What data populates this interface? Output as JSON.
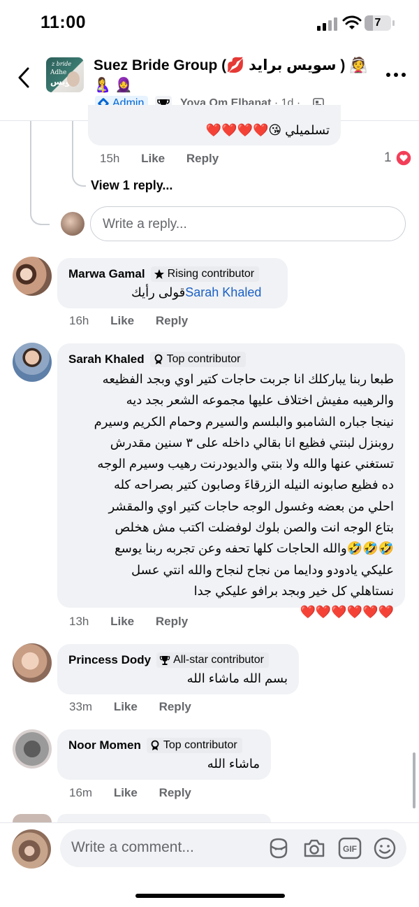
{
  "status_bar": {
    "time": "11:00",
    "battery": "7"
  },
  "header": {
    "group_name": "Suez Bride Group (💋 سويس برايد ) 👰",
    "group_name_emoji_tail": "🤰",
    "group_name_emoji_line2": "🤱 🧕",
    "avatar_text_1": "z bride",
    "avatar_text_2": "Adhe",
    "avatar_text_3": "سويس",
    "admin_label": "Admin",
    "author": "Yoya Om Elbanat",
    "age": "· 1d ·"
  },
  "thread": {
    "prev_reply": {
      "text": "تسلميلي 😘❤️❤️❤️❤️",
      "time": "15h",
      "like": "Like",
      "reply": "Reply",
      "reaction_count": "1"
    },
    "view_replies": "View 1 reply...",
    "reply_input_placeholder": "Write a reply..."
  },
  "comments": [
    {
      "name": "Marwa Gamal",
      "badge": "Rising contributor",
      "mention": "Sarah Khaled",
      "text": "قولى رأيك",
      "time": "16h",
      "like": "Like",
      "reply": "Reply"
    },
    {
      "name": "Sarah Khaled",
      "badge": "Top contributor",
      "lines": [
        "طبعا ربنا يباركلك انا جربت حاجات كتير اوي وبجد الفظيعه",
        "والرهيبه مفيش اختلاف عليها مجموعه الشعر بجد ديه",
        "نينجا جباره الشامبو والبلسم والسيرم وحمام الكريم وسيرم",
        "روبنزل لبنتي فظيع انا بقالي داخله على ٣ سنين مقدرش",
        "تستغني عنها والله ولا بنتي والديودرنت رهيب وسيرم الوجه",
        "ده فظيع صابونه النيله الزرقاءَ وصابون كتير بصراحه كله",
        "احلي من بعضه وغسول الوجه حاجات كتير اوي والمقشر",
        "بتاع الوجه انت والصن بلوك  لوفضلت  اكتب مش هخلص",
        "🤣🤣🤣والله الحاجات كلها تحفه وعن تجربه ربنا يوسع",
        "عليكي يادودو ودايما من نجاح لنجاح والله انتي عسل",
        "نستاهلي كل خير وبجد برافو عليكي جدا",
        "❤️❤️❤️❤️❤️❤️"
      ],
      "time": "13h",
      "like": "Like",
      "reply": "Reply"
    },
    {
      "name": "Princess Dody",
      "badge": "All-star contributor",
      "text": "بسم الله ماشاء الله",
      "time": "33m",
      "like": "Like",
      "reply": "Reply"
    },
    {
      "name": "Noor Momen",
      "badge": "Top contributor",
      "text": "ماشاء الله",
      "time": "16m",
      "like": "Like",
      "reply": "Reply"
    }
  ],
  "composer": {
    "placeholder": "Write a comment..."
  }
}
